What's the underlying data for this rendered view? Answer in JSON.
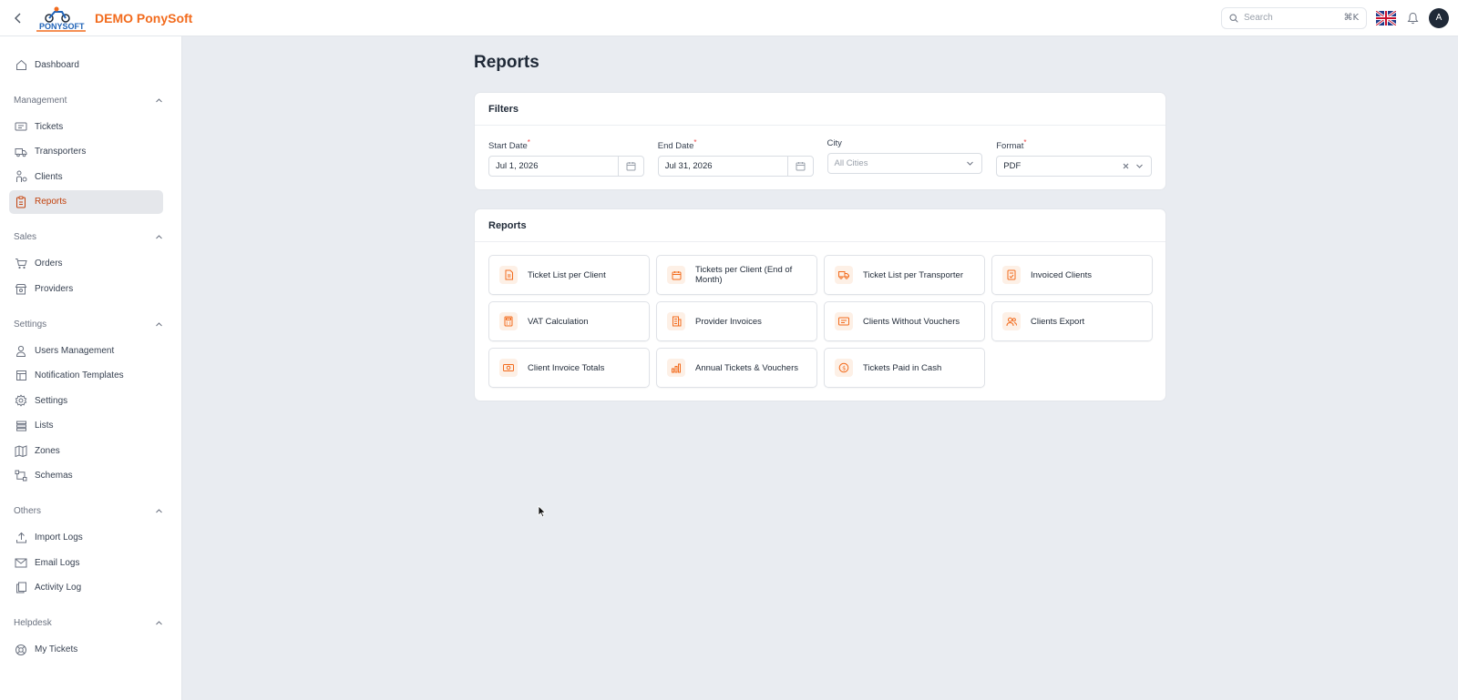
{
  "app": {
    "brand": "DEMO PonySoft",
    "logo_text": "PONYSOFT",
    "accent_color": "#f26b1d"
  },
  "topbar": {
    "search_placeholder": "Search",
    "search_shortcut": "⌘K",
    "language": "en-GB",
    "avatar_initial": "A"
  },
  "sidebar": {
    "dashboard": "Dashboard",
    "sections": {
      "management": {
        "title": "Management",
        "items": [
          "Tickets",
          "Transporters",
          "Clients",
          "Reports"
        ]
      },
      "sales": {
        "title": "Sales",
        "items": [
          "Orders",
          "Providers"
        ]
      },
      "settings": {
        "title": "Settings",
        "items": [
          "Users Management",
          "Notification Templates",
          "Settings",
          "Lists",
          "Zones",
          "Schemas"
        ]
      },
      "others": {
        "title": "Others",
        "items": [
          "Import Logs",
          "Email Logs",
          "Activity Log"
        ]
      },
      "helpdesk": {
        "title": "Helpdesk",
        "items": [
          "My Tickets"
        ]
      }
    },
    "active_item": "Reports"
  },
  "main": {
    "title": "Reports",
    "filters": {
      "title": "Filters",
      "start_date": {
        "label": "Start Date",
        "value": "Jul 1, 2026"
      },
      "end_date": {
        "label": "End Date",
        "value": "Jul 31, 2026"
      },
      "city": {
        "label": "City",
        "placeholder": "All Cities"
      },
      "format": {
        "label": "Format",
        "value": "PDF"
      },
      "required_mark": "*"
    },
    "reports": {
      "title": "Reports",
      "items": [
        {
          "label": "Ticket List per Client",
          "icon": "document-icon"
        },
        {
          "label": "Tickets per Client (End of Month)",
          "icon": "calendar-icon"
        },
        {
          "label": "Ticket List per Transporter",
          "icon": "truck-icon"
        },
        {
          "label": "Invoiced Clients",
          "icon": "invoice-icon"
        },
        {
          "label": "VAT Calculation",
          "icon": "calculator-icon"
        },
        {
          "label": "Provider Invoices",
          "icon": "building-icon"
        },
        {
          "label": "Clients Without Vouchers",
          "icon": "ticket-icon"
        },
        {
          "label": "Clients Export",
          "icon": "users-icon"
        },
        {
          "label": "Client Invoice Totals",
          "icon": "money-icon"
        },
        {
          "label": "Annual Tickets & Vouchers",
          "icon": "bar-chart-icon"
        },
        {
          "label": "Tickets Paid in Cash",
          "icon": "coin-icon"
        }
      ]
    }
  }
}
